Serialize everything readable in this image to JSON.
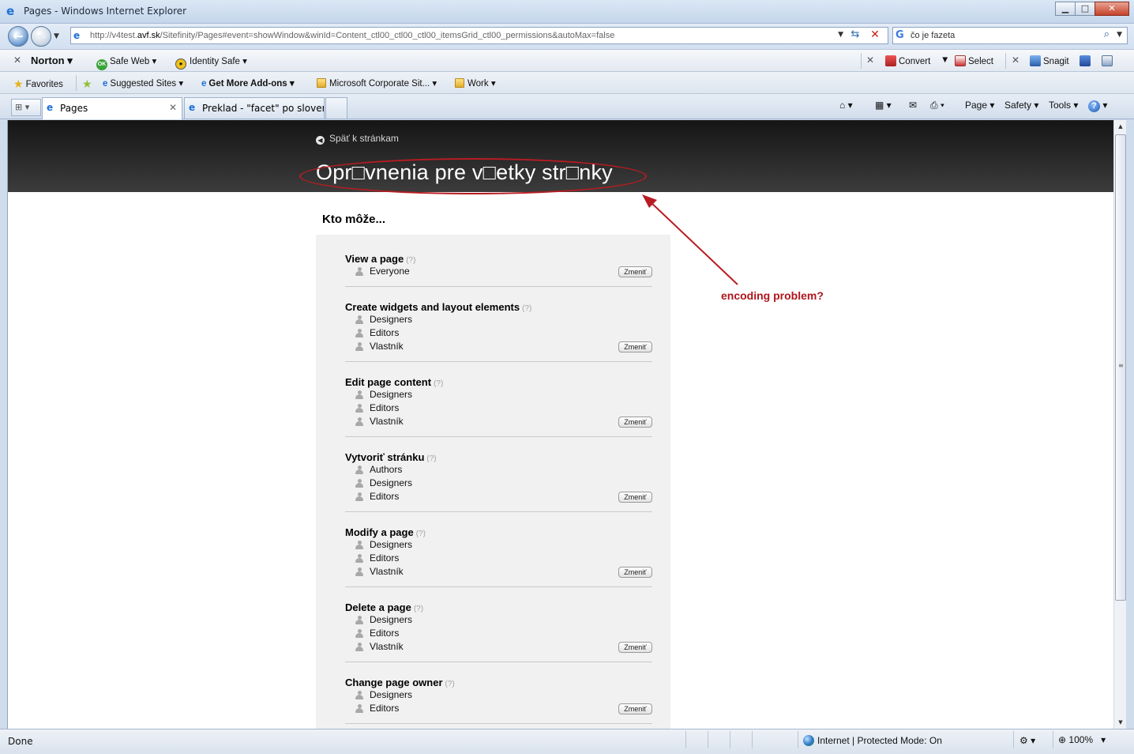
{
  "window": {
    "title": "Pages - Windows Internet Explorer",
    "minimize": "▁",
    "maximize": "□",
    "close": "✕"
  },
  "address": {
    "url_prefix": "http://v4test.",
    "url_domain": "avf.sk",
    "url_suffix": "/Sitefinity/Pages#event=showWindow&winId=Content_ctl00_ctl00_ctl00_itemsGrid_ctl00_permissions&autoMax=false",
    "search_value": "čo je fazeta"
  },
  "norton_toolbar": {
    "norton": "Norton",
    "safe_web": "Safe Web",
    "safe_web_badge": "OK",
    "identity_safe": "Identity Safe",
    "convert": "Convert",
    "select": "Select",
    "snagit": "Snagit"
  },
  "favorites_bar": {
    "favorites": "Favorites",
    "items": [
      {
        "label": "Suggested Sites ▾"
      },
      {
        "label": "Get More Add-ons ▾"
      },
      {
        "label": "Microsoft Corporate Sit... ▾"
      },
      {
        "label": "Work ▾"
      }
    ]
  },
  "tabs": [
    {
      "label": "Pages",
      "active": true
    },
    {
      "label": "Preklad - \"facet\" po sloven...",
      "active": false
    }
  ],
  "command_bar": {
    "page": "Page ▾",
    "safety": "Safety ▾",
    "tools": "Tools ▾",
    "help": "?"
  },
  "page": {
    "back_link": "Späť k stránkam",
    "heading": "Opr□vnenia pre v□etky str□nky",
    "section_title": "Kto môže...",
    "help_marker": "(?)",
    "change_button": "Zmeniť",
    "permissions": [
      {
        "title": "View a page",
        "groups": [
          "Everyone"
        ]
      },
      {
        "title": "Create widgets and layout elements",
        "groups": [
          "Designers",
          "Editors",
          "Vlastník"
        ]
      },
      {
        "title": "Edit page content",
        "groups": [
          "Designers",
          "Editors",
          "Vlastník"
        ]
      },
      {
        "title": "Vytvoriť stránku",
        "groups": [
          "Authors",
          "Designers",
          "Editors"
        ]
      },
      {
        "title": "Modify a page",
        "groups": [
          "Designers",
          "Editors",
          "Vlastník"
        ]
      },
      {
        "title": "Delete a page",
        "groups": [
          "Designers",
          "Editors",
          "Vlastník"
        ]
      },
      {
        "title": "Change page owner",
        "groups": [
          "Designers",
          "Editors"
        ]
      }
    ]
  },
  "annotation": {
    "text": "encoding problem?",
    "color": "#b81c22"
  },
  "status_bar": {
    "status": "Done",
    "zone": "Internet | Protected Mode: On",
    "zoom": "100%"
  }
}
